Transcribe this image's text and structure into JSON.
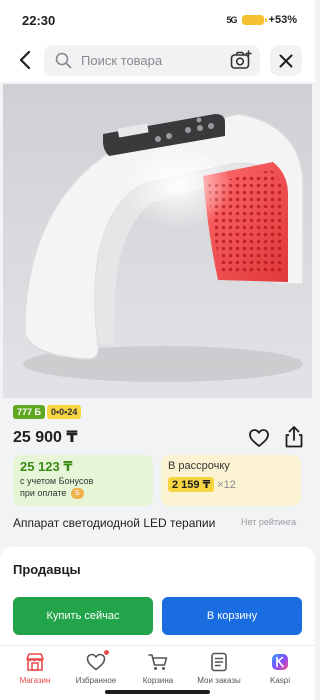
{
  "status": {
    "time": "22:30",
    "signal": "5G",
    "battery": "+53%"
  },
  "search": {
    "placeholder": "Поиск товара"
  },
  "product": {
    "badges": {
      "green": "777 Б",
      "yellow": "0•0•24"
    },
    "price": "25 900 ₸",
    "bonus": {
      "price": "25 123 ₸",
      "note_line1": "с учетом Бонусов",
      "note_line2": "при оплате",
      "coin_label": "Б"
    },
    "installment": {
      "title": "В рассрочку",
      "amount": "2 159 ₸",
      "months": "×12"
    },
    "title": "Аппарат светодиодной LED терапии",
    "rating": "Нет рейтинга"
  },
  "sellers": {
    "title": "Продавцы"
  },
  "actions": {
    "buy_now": "Купить сейчас",
    "add_to_cart": "В корзину"
  },
  "nav": {
    "items": [
      {
        "label": "Магазин",
        "icon": "shop-icon",
        "active": true
      },
      {
        "label": "Избранное",
        "icon": "heart-icon",
        "active": false
      },
      {
        "label": "Корзина",
        "icon": "cart-icon",
        "active": false
      },
      {
        "label": "Мои заказы",
        "icon": "orders-icon",
        "active": false
      },
      {
        "label": "Kaspi",
        "icon": "kaspi-icon",
        "active": false
      }
    ]
  },
  "colors": {
    "accent_red": "#e84b4b",
    "buy_green": "#22a44a",
    "cart_blue": "#1a6de0",
    "bonus_green": "#3b8a16"
  }
}
